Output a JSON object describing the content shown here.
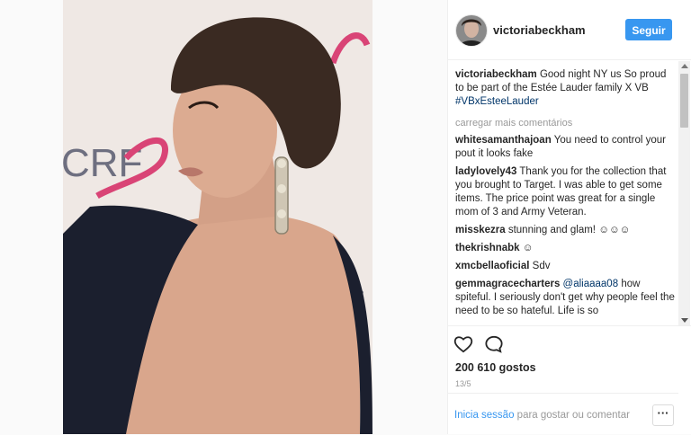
{
  "header": {
    "username": "victoriabeckham",
    "follow_label": "Seguir"
  },
  "caption": {
    "user": "victoriabeckham",
    "text": "Good night NY us So proud to be part of the Estée Lauder family X VB",
    "hashtag": "#VBxEsteeLauder"
  },
  "load_more": "carregar mais comentários",
  "comments": [
    {
      "user": "whitesamanthajoan",
      "text": "You need to control your pout it looks fake"
    },
    {
      "user": "ladylovely43",
      "text": "Thank you for the collection that you brought to Target. I was able to get some items. The price point was great for a single mom of 3 and Army Veteran."
    },
    {
      "user": "misskezra",
      "text": "stunning and glam! ☺☺☺"
    },
    {
      "user": "thekrishnabk",
      "text": "☺"
    },
    {
      "user": "xmcbellaoficial",
      "text": "Sdv"
    },
    {
      "user": "gemmagracecharters",
      "mention": "@aliaaaa08",
      "text": "how spiteful. I seriously don't get why people feel the need to be so hateful. Life is so"
    }
  ],
  "likes": "200 610 gostos",
  "date": "13/5",
  "footer": {
    "login_link": "Inicia sessão",
    "login_text": " para gostar ou comentar",
    "more_label": "···"
  },
  "colors": {
    "accent": "#3897f0",
    "link": "#003569",
    "ribbon": "#e0457b"
  },
  "icons": [
    "heart-icon",
    "comment-icon",
    "more-options-icon"
  ]
}
